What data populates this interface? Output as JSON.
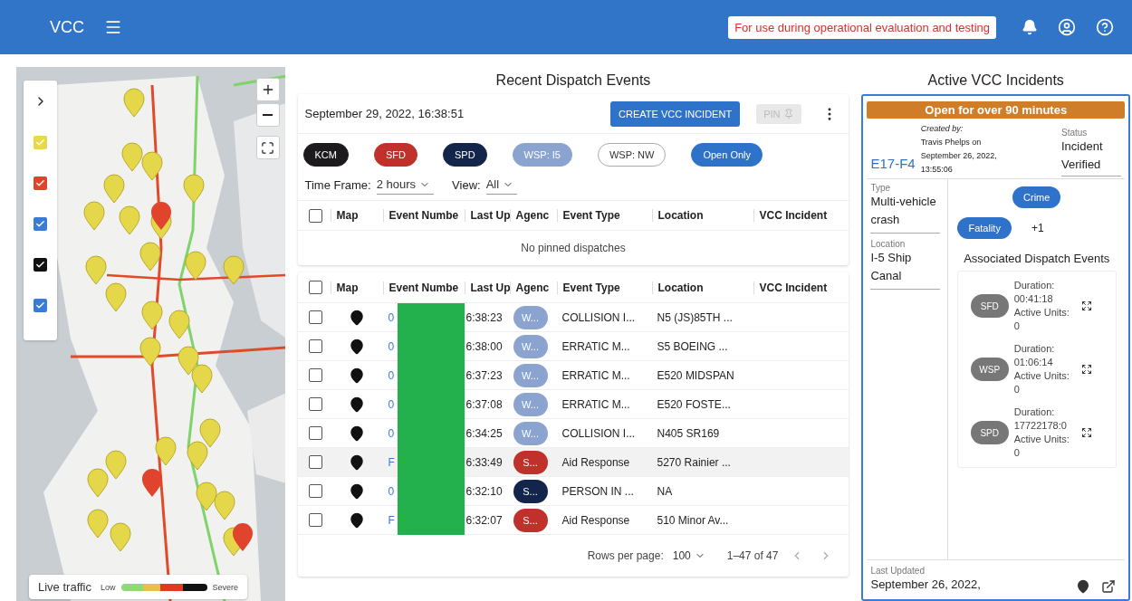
{
  "header": {
    "title": "VCC",
    "notice": "For use during operational evaluation and testing"
  },
  "map": {
    "layers": [
      {
        "color": "#e8d84a",
        "checked": true
      },
      {
        "color": "#e0442c",
        "checked": true
      },
      {
        "color": "#3a7bd5",
        "checked": true
      },
      {
        "color": "#111111",
        "checked": true
      },
      {
        "color": "#3a7bd5",
        "checked": true
      }
    ],
    "legend": {
      "title": "Live traffic",
      "low": "Low",
      "high": "Severe"
    }
  },
  "dispatch": {
    "title": "Recent Dispatch Events",
    "timestamp": "September 29, 2022, 16:38:51",
    "create_button": "CREATE VCC INCIDENT",
    "pin_button": {
      "label": "PIN",
      "disabled": true
    },
    "filters": [
      {
        "label": "KCM",
        "color": "#1c1a1d",
        "selected": true
      },
      {
        "label": "SFD",
        "color": "#c0312b",
        "selected": true
      },
      {
        "label": "SPD",
        "color": "#13254a",
        "selected": true
      },
      {
        "label": "WSP: I5",
        "color": "#8aa4cf",
        "selected": true
      },
      {
        "label": "WSP: NW",
        "color": "#aaaaaa",
        "selected": false
      },
      {
        "label": "Open Only",
        "color": "#2f72c9",
        "selected": true
      }
    ],
    "time_frame": {
      "label": "Time Frame:",
      "value": "2 hours"
    },
    "view": {
      "label": "View:",
      "value": "All"
    },
    "pinned_select_all": {
      "checked": false
    },
    "pinned_columns": [
      "Map",
      "Event Numbe",
      "Last Up",
      "Agenc",
      "Event Type",
      "Location",
      "VCC Incident"
    ],
    "pinned_empty": "No pinned dispatches",
    "select_all": {
      "checked": false
    },
    "columns": [
      "Map",
      "Event Numbe",
      "Last Up",
      "Agenc",
      "Event Type",
      "Location",
      "VCC Incident"
    ],
    "rows": [
      {
        "selected": false,
        "hovered": false,
        "event_number": "0",
        "last_update": "6:38:23",
        "agency": {
          "label": "W...",
          "color": "#8aa4cf"
        },
        "event_type": "COLLISION I...",
        "location": "N5 (JS)85TH ..."
      },
      {
        "selected": false,
        "hovered": false,
        "event_number": "0",
        "last_update": "6:38:00",
        "agency": {
          "label": "W...",
          "color": "#8aa4cf"
        },
        "event_type": "ERRATIC M...",
        "location": "S5 BOEING ..."
      },
      {
        "selected": false,
        "hovered": false,
        "event_number": "0",
        "last_update": "6:37:23",
        "agency": {
          "label": "W...",
          "color": "#8aa4cf"
        },
        "event_type": "ERRATIC M...",
        "location": "E520 MIDSPAN"
      },
      {
        "selected": false,
        "hovered": false,
        "event_number": "0",
        "last_update": "6:37:08",
        "agency": {
          "label": "W...",
          "color": "#8aa4cf"
        },
        "event_type": "ERRATIC M...",
        "location": "E520 FOSTE..."
      },
      {
        "selected": false,
        "hovered": false,
        "event_number": "0",
        "last_update": "6:34:25",
        "agency": {
          "label": "W...",
          "color": "#8aa4cf"
        },
        "event_type": "COLLISION I...",
        "location": "N405 SR169"
      },
      {
        "selected": false,
        "hovered": true,
        "event_number": "F",
        "last_update": "6:33:49",
        "agency": {
          "label": "S...",
          "color": "#c0312b"
        },
        "event_type": "Aid Response",
        "location": "5270 Rainier ..."
      },
      {
        "selected": false,
        "hovered": false,
        "event_number": "0",
        "last_update": "6:32:10",
        "agency": {
          "label": "S...",
          "color": "#13254a"
        },
        "event_type": "PERSON IN ...",
        "location": "NA"
      },
      {
        "selected": false,
        "hovered": false,
        "event_number": "F",
        "last_update": "6:32:07",
        "agency": {
          "label": "S...",
          "color": "#c0312b"
        },
        "event_type": "Aid Response",
        "location": "510 Minor Av..."
      }
    ],
    "pagination": {
      "rows_label": "Rows per page:",
      "rows_value": "100",
      "range": "1–47 of 47"
    }
  },
  "incidents": {
    "title": "Active VCC Incidents",
    "card": {
      "banner": "Open for over 90 minutes",
      "id": "E17-F4",
      "created_label": "Created by:",
      "created_text": "Travis Phelps on September 26, 2022, 13:55:06",
      "status_label": "Status",
      "status": "Incident Verified",
      "type_label": "Type",
      "type": "Multi-vehicle crash",
      "location_label": "Location",
      "location": "I-5 Ship Canal",
      "tags": [
        "Crime",
        "Fatality"
      ],
      "more": "+1",
      "assoc_title": "Associated Dispatch Events",
      "events": [
        {
          "agency": "SFD",
          "duration_label": "Duration:",
          "duration": "00:41:18",
          "units": "Active Units: 0"
        },
        {
          "agency": "WSP",
          "duration_label": "Duration:",
          "duration": "01:06:14",
          "units": "Active Units: 0"
        },
        {
          "agency": "SPD",
          "duration_label": "Duration:",
          "duration": "17722178:0",
          "units": "Active Units: 0"
        }
      ],
      "last_updated_label": "Last Updated",
      "last_updated": "September 26, 2022,"
    }
  }
}
